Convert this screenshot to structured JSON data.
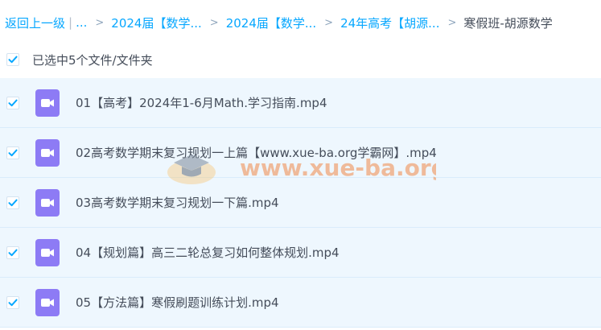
{
  "breadcrumb": {
    "back": "返回上一级",
    "separator": "|",
    "ellipsis": "...",
    "items": [
      "2024届【数学...",
      "2024届【数学...",
      "24年高考【胡源..."
    ],
    "current": "寒假班-胡源数学"
  },
  "selection": {
    "text": "已选中5个文件/文件夹"
  },
  "files": [
    {
      "name": "01【高考】2024年1-6月Math.学习指南.mp4"
    },
    {
      "name": "02高考数学期末复习规划一上篇【www.xue-ba.org学霸网】.mp4"
    },
    {
      "name": "03高考数学期末复习规划一下篇.mp4"
    },
    {
      "name": "04【规划篇】高三二轮总复习如何整体规划.mp4"
    },
    {
      "name": "05【方法篇】寒假刷题训练计划.mp4"
    }
  ],
  "watermark": {
    "text": "www.xue-ba.org"
  },
  "colors": {
    "accent": "#06a7ff",
    "row_bg": "#eef7fe",
    "video_icon": "#8d7bf5",
    "watermark": "#f08a4a"
  }
}
